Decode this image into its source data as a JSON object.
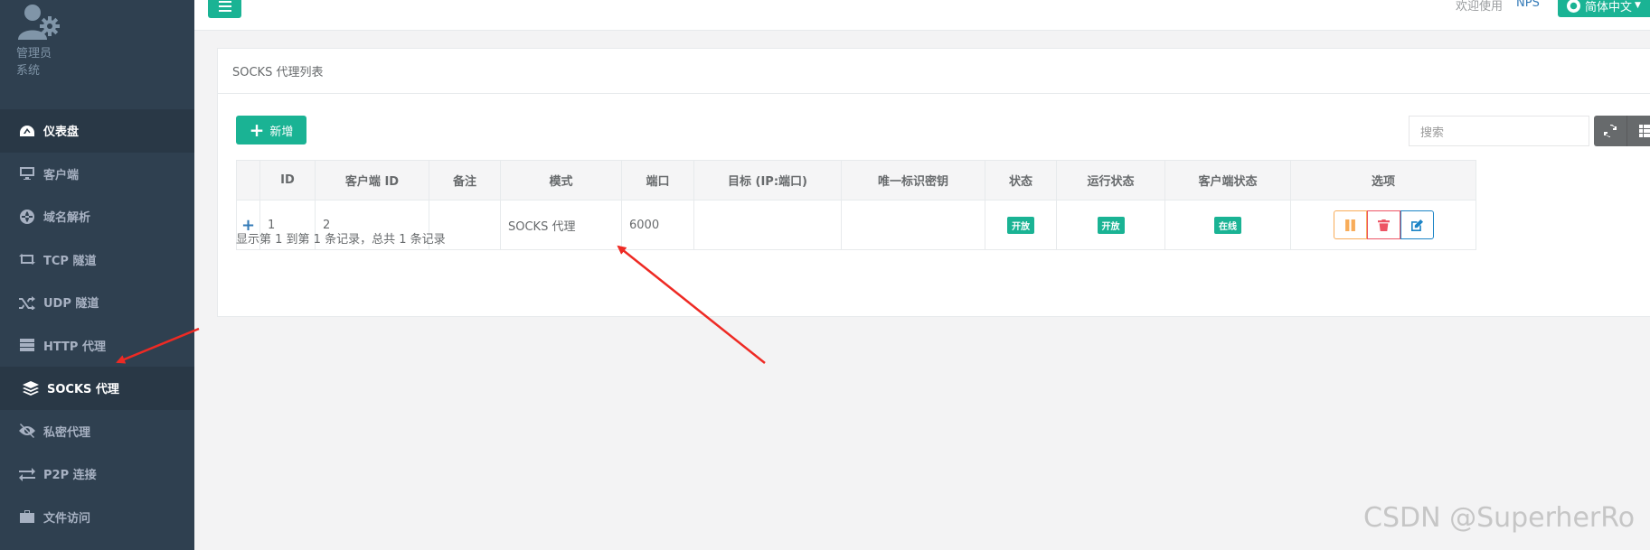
{
  "sidebar": {
    "profile": {
      "line1": "管理员",
      "line2": "系统"
    },
    "items": [
      {
        "label": "仪表盘",
        "icon": "dashboard-icon",
        "state": "active"
      },
      {
        "label": "客户端",
        "icon": "monitor-icon",
        "state": ""
      },
      {
        "label": "域名解析",
        "icon": "globe-icon",
        "state": ""
      },
      {
        "label": "TCP 隧道",
        "icon": "retweet-icon",
        "state": ""
      },
      {
        "label": "UDP 隧道",
        "icon": "random-icon",
        "state": ""
      },
      {
        "label": "HTTP 代理",
        "icon": "server-icon",
        "state": ""
      },
      {
        "label": "SOCKS 代理",
        "icon": "layers-icon",
        "state": "selected"
      },
      {
        "label": "私密代理",
        "icon": "eye-slash-icon",
        "state": ""
      },
      {
        "label": "P2P 连接",
        "icon": "exchange-icon",
        "state": ""
      },
      {
        "label": "文件访问",
        "icon": "briefcase-icon",
        "state": ""
      }
    ]
  },
  "topbar": {
    "welcome": "欢迎使用",
    "nps": "NPS",
    "language": "简体中文"
  },
  "panel": {
    "title": "SOCKS 代理列表",
    "add_label": "新增",
    "search_placeholder": "搜索",
    "columns": [
      "",
      "ID",
      "客户端 ID",
      "备注",
      "模式",
      "端口",
      "目标 (IP:端口)",
      "唯一标识密钥",
      "状态",
      "运行状态",
      "客户端状态",
      "选项"
    ],
    "rows": [
      {
        "expand": "+",
        "id": "1",
        "client_id": "2",
        "remark": "",
        "mode": "SOCKS 代理",
        "port": "6000",
        "target": "",
        "key": "",
        "status": "开放",
        "run_status": "开放",
        "client_status": "在线"
      }
    ],
    "footer": "显示第 1 到第 1 条记录，总共 1 条记录"
  },
  "watermark": "CSDN @SuperherRo",
  "colors": {
    "sidebar": "#2f4050",
    "primary": "#1ab394",
    "warning": "#f8ac59",
    "danger": "#ed5565",
    "info": "#1c84c6",
    "arrow": "#ee2a24"
  }
}
